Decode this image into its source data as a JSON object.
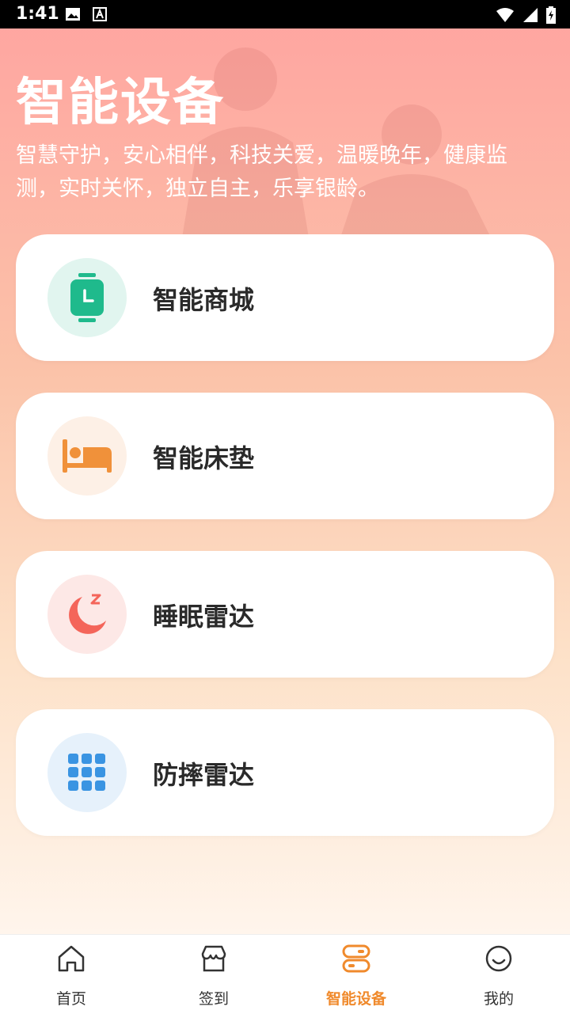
{
  "status": {
    "time": "1:41"
  },
  "header": {
    "title": "智能设备",
    "description": "智慧守护，安心相伴，科技关爱，温暖晚年，健康监测，实时关怀，独立自主，乐享银龄。"
  },
  "devices": [
    {
      "label": "智能商城",
      "icon": "watch-icon",
      "circle_color": "#e1f5ef",
      "icon_color": "#1fba8c"
    },
    {
      "label": "智能床垫",
      "icon": "bed-icon",
      "circle_color": "#fdf0e6",
      "icon_color": "#f0913a"
    },
    {
      "label": "睡眠雷达",
      "icon": "moon-icon",
      "circle_color": "#fde8e6",
      "icon_color": "#f4655a"
    },
    {
      "label": "防摔雷达",
      "icon": "grid-icon",
      "circle_color": "#e6f1fb",
      "icon_color": "#3a94e2"
    }
  ],
  "tabbar": {
    "active_color": "#f08a2c",
    "items": [
      {
        "label": "首页",
        "icon": "home-icon"
      },
      {
        "label": "签到",
        "icon": "shop-icon"
      },
      {
        "label": "智能设备",
        "icon": "device-icon"
      },
      {
        "label": "我的",
        "icon": "smile-icon"
      }
    ]
  }
}
